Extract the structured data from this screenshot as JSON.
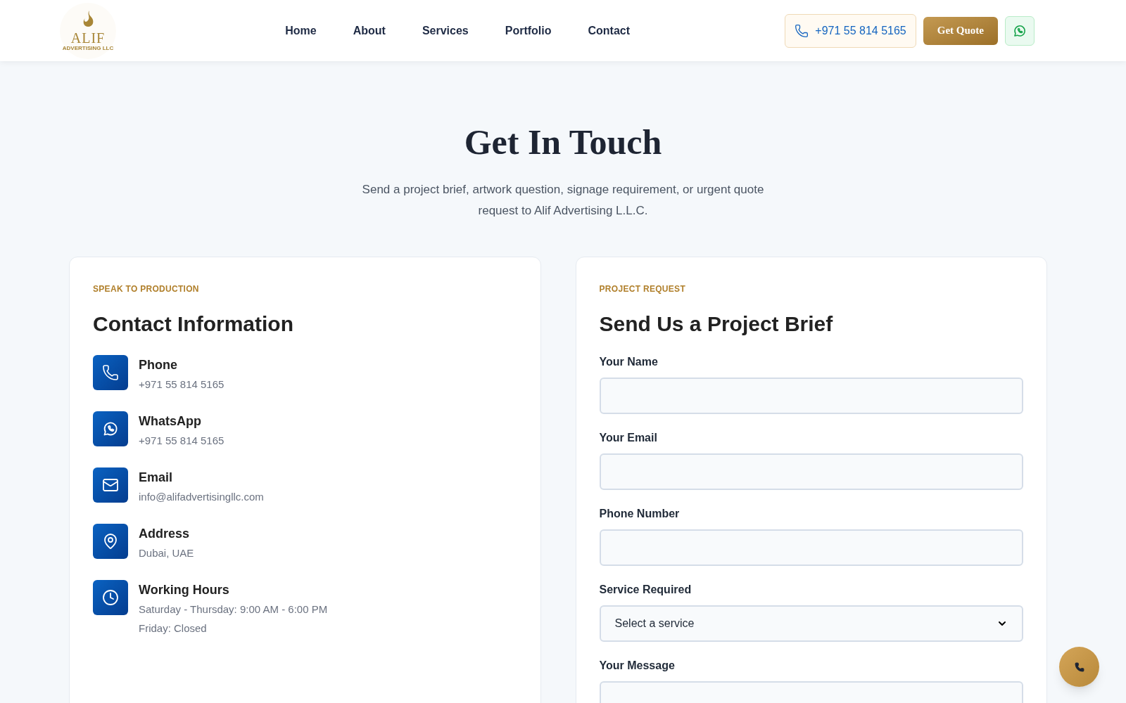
{
  "header": {
    "logo": {
      "name": "ALIF",
      "tagline": "ADVERTISING LLC"
    },
    "nav": [
      {
        "label": "Home"
      },
      {
        "label": "About"
      },
      {
        "label": "Services"
      },
      {
        "label": "Portfolio"
      },
      {
        "label": "Contact"
      }
    ],
    "phone_button": "+971 55 814 5165",
    "quote_button": "Get Quote"
  },
  "hero": {
    "title": "Get In Touch",
    "subtitle": "Send a project brief, artwork question, signage requirement, or urgent quote request to Alif Advertising L.L.C."
  },
  "contact_card": {
    "eyebrow": "SPEAK TO PRODUCTION",
    "title": "Contact Information",
    "items": [
      {
        "kind": "phone",
        "label": "Phone",
        "lines": [
          "+971 55 814 5165"
        ]
      },
      {
        "kind": "whatsapp",
        "label": "WhatsApp",
        "lines": [
          "+971 55 814 5165"
        ]
      },
      {
        "kind": "email",
        "label": "Email",
        "lines": [
          "info@alifadvertisingllc.com"
        ]
      },
      {
        "kind": "address",
        "label": "Address",
        "lines": [
          "Dubai, UAE"
        ]
      },
      {
        "kind": "hours",
        "label": "Working Hours",
        "lines": [
          "Saturday - Thursday: 9:00 AM - 6:00 PM",
          "Friday: Closed"
        ]
      }
    ]
  },
  "form_card": {
    "eyebrow": "PROJECT REQUEST",
    "title": "Send Us a Project Brief",
    "fields": [
      {
        "kind": "input",
        "label": "Your Name"
      },
      {
        "kind": "input",
        "label": "Your Email"
      },
      {
        "kind": "input",
        "label": "Phone Number"
      },
      {
        "kind": "select",
        "label": "Service Required",
        "value": "Select a service"
      },
      {
        "kind": "textarea",
        "label": "Your Message"
      }
    ]
  }
}
